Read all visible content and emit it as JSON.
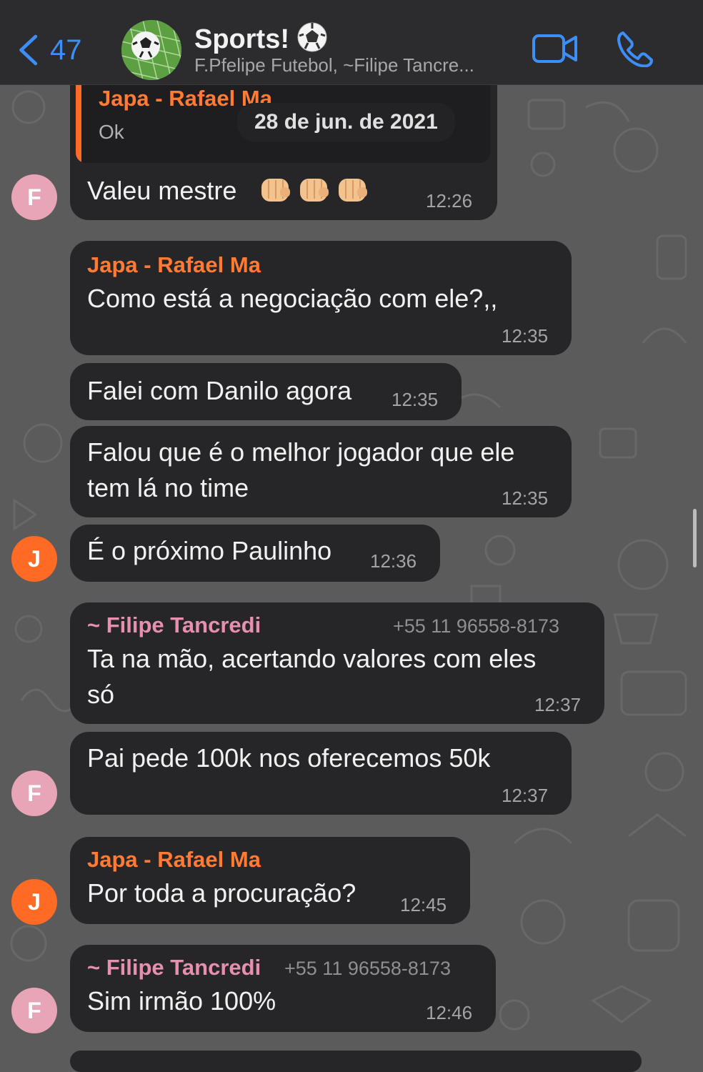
{
  "header": {
    "back_count": "47",
    "title": "Sports!",
    "subtitle": "F.Pfelipe Futebol, ~Filipe Tancre..."
  },
  "colors": {
    "accent_blue": "#3d8ef7",
    "orange_sender": "#ff7a33",
    "pink_sender": "#e68fae",
    "bubble": "#262628"
  },
  "date_pill": "28 de jun. de 2021",
  "messages": [
    {
      "quote_sender": "Japa - Rafael Ma",
      "quote_text": "Ok",
      "text": "Valeu mestre",
      "emoji": "fist-bump-emoji",
      "time": "12:26",
      "avatar": "F"
    },
    {
      "sender": "Japa - Rafael Ma",
      "text": "Como está a negociação com ele?,,",
      "time": "12:35"
    },
    {
      "text": "Falei com Danilo agora",
      "time": "12:35"
    },
    {
      "text_line1": "Falou que é o melhor jogador que ele",
      "text_line2": "tem lá no time",
      "time": "12:35"
    },
    {
      "text": "É o próximo Paulinho",
      "time": "12:36",
      "avatar": "J"
    },
    {
      "sender": "~ Filipe Tancredi",
      "phone": "+55 11 96558-8173",
      "text_line1": "Ta na mão, acertando valores com eles",
      "text_line2": "só",
      "time": "12:37"
    },
    {
      "text": "Pai pede 100k nos oferecemos 50k",
      "time": "12:37",
      "avatar": "F"
    },
    {
      "sender": "Japa - Rafael Ma",
      "text": "Por toda a procuração?",
      "time": "12:45",
      "avatar": "J"
    },
    {
      "sender": "~ Filipe Tancredi",
      "phone": "+55 11 96558-8173",
      "text": "Sim irmão 100%",
      "time": "12:46",
      "avatar": "F"
    }
  ]
}
